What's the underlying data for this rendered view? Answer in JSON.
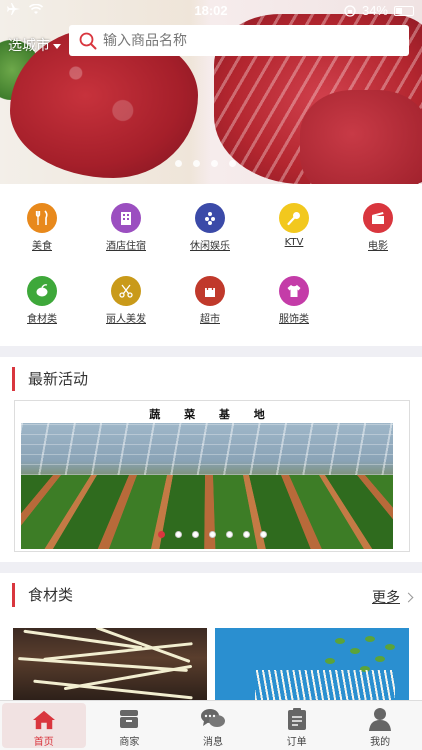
{
  "status_bar": {
    "time": "18:02",
    "battery": "34%"
  },
  "header": {
    "city_label": "选城市",
    "search_placeholder": "输入商品名称"
  },
  "categories": [
    {
      "label": "美食",
      "icon": "fork-knife-icon",
      "color": "#e8891c"
    },
    {
      "label": "酒店住宿",
      "icon": "building-icon",
      "color": "#9b4fc0"
    },
    {
      "label": "休闲娱乐",
      "icon": "bowling-icon",
      "color": "#3b4aa8"
    },
    {
      "label": "KTV",
      "icon": "microphone-icon",
      "color": "#f2c81e"
    },
    {
      "label": "电影",
      "icon": "clapperboard-icon",
      "color": "#d9363e"
    },
    {
      "label": "食材类",
      "icon": "vegetable-icon",
      "color": "#3ea83a"
    },
    {
      "label": "丽人美发",
      "icon": "scissors-icon",
      "color": "#c99a1a"
    },
    {
      "label": "超市",
      "icon": "shopping-bag-icon",
      "color": "#c0392b"
    },
    {
      "label": "服饰类",
      "icon": "tshirt-icon",
      "color": "#c43ca8"
    }
  ],
  "activity": {
    "title": "最新活动",
    "banner_caption": "蔬 菜 基 地"
  },
  "food_section": {
    "title": "食材类",
    "more": "更多"
  },
  "tabs": [
    {
      "label": "首页",
      "icon": "home-icon",
      "active": true
    },
    {
      "label": "商家",
      "icon": "store-icon",
      "active": false
    },
    {
      "label": "消息",
      "icon": "chat-icon",
      "active": false
    },
    {
      "label": "订单",
      "icon": "order-icon",
      "active": false
    },
    {
      "label": "我的",
      "icon": "user-icon",
      "active": false
    }
  ],
  "colors": {
    "accent": "#d9363e"
  }
}
